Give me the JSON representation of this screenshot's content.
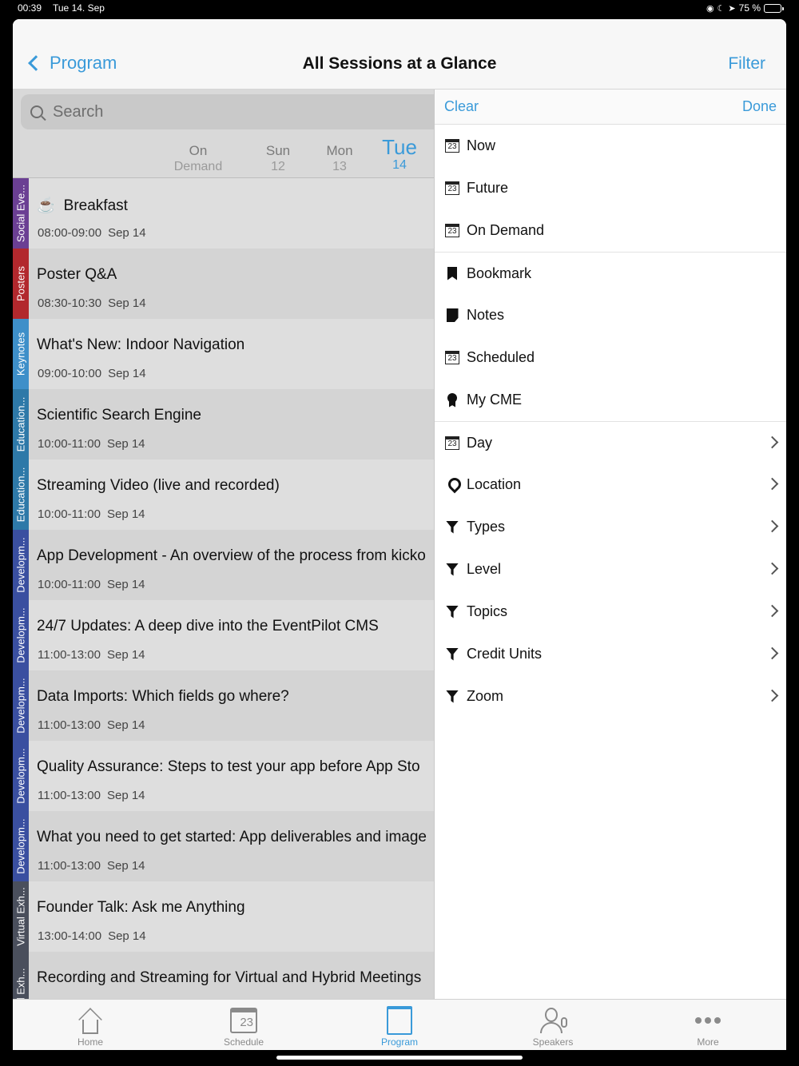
{
  "status_bar": {
    "time": "00:39",
    "date": "Tue 14. Sep",
    "battery_text": "75 %",
    "battery_level": 0.75
  },
  "nav": {
    "back_label": "Program",
    "title": "All Sessions at a Glance",
    "filter_label": "Filter"
  },
  "search": {
    "placeholder": "Search"
  },
  "days": [
    {
      "name": "On",
      "num": "Demand"
    },
    {
      "name": "Sun",
      "num": "12"
    },
    {
      "name": "Mon",
      "num": "13"
    },
    {
      "name": "Tue",
      "num": "14"
    }
  ],
  "sessions": [
    {
      "tag": "Social Eve...",
      "color": "#6b3f93",
      "title": "Breakfast",
      "time": "08:00-09:00",
      "date": "Sep 14",
      "icon": "coffee-icon"
    },
    {
      "tag": "Posters",
      "color": "#b2282d",
      "title": "Poster Q&A",
      "time": "08:30-10:30",
      "date": "Sep 14"
    },
    {
      "tag": "Keynotes",
      "color": "#3e8fc9",
      "title": "What's New: Indoor Navigation",
      "time": "09:00-10:00",
      "date": "Sep 14"
    },
    {
      "tag": "Education...",
      "color": "#2e79a8",
      "title": "Scientific Search Engine",
      "time": "10:00-11:00",
      "date": "Sep 14"
    },
    {
      "tag": "Education...",
      "color": "#2e79a8",
      "title": "Streaming Video (live and recorded)",
      "time": "10:00-11:00",
      "date": "Sep 14"
    },
    {
      "tag": "Developm...",
      "color": "#3a4fa0",
      "title": "App Development - An overview of the process from kicko",
      "time": "10:00-11:00",
      "date": "Sep 14"
    },
    {
      "tag": "Developm...",
      "color": "#3a4fa0",
      "title": "24/7 Updates: A deep dive into the EventPilot CMS",
      "time": "11:00-13:00",
      "date": "Sep 14"
    },
    {
      "tag": "Developm...",
      "color": "#3a4fa0",
      "title": "Data Imports: Which fields go where?",
      "time": "11:00-13:00",
      "date": "Sep 14"
    },
    {
      "tag": "Developm...",
      "color": "#3a4fa0",
      "title": "Quality Assurance: Steps to test your app before App Sto",
      "time": "11:00-13:00",
      "date": "Sep 14"
    },
    {
      "tag": "Developm...",
      "color": "#3a4fa0",
      "title": "What you need to get started: App deliverables and image",
      "time": "11:00-13:00",
      "date": "Sep 14"
    },
    {
      "tag": "Virtual Exh...",
      "color": "#4a4f5c",
      "title": "Founder Talk: Ask me Anything",
      "time": "13:00-14:00",
      "date": "Sep 14"
    },
    {
      "tag": "al Exh...",
      "color": "#4a4f5c",
      "title": "Recording and Streaming for Virtual and Hybrid Meetings",
      "time": "",
      "date": ""
    }
  ],
  "filter_panel": {
    "clear_label": "Clear",
    "done_label": "Done",
    "items": [
      {
        "label": "Now",
        "icon": "calendar-icon",
        "cal_num": "23"
      },
      {
        "label": "Future",
        "icon": "calendar-icon",
        "cal_num": "23"
      },
      {
        "label": "On Demand",
        "icon": "calendar-icon",
        "cal_num": "23"
      },
      {
        "label": "Bookmark",
        "icon": "bookmark-icon"
      },
      {
        "label": "Notes",
        "icon": "notes-icon"
      },
      {
        "label": "Scheduled",
        "icon": "calendar-icon",
        "cal_num": "23"
      },
      {
        "label": "My CME",
        "icon": "medal-icon"
      },
      {
        "label": "Day",
        "icon": "calendar-icon",
        "cal_num": "23"
      },
      {
        "label": "Location",
        "icon": "location-pin-icon"
      },
      {
        "label": "Types",
        "icon": "funnel-icon"
      },
      {
        "label": "Level",
        "icon": "funnel-icon"
      },
      {
        "label": "Topics",
        "icon": "funnel-icon"
      },
      {
        "label": "Credit Units",
        "icon": "funnel-icon"
      },
      {
        "label": "Zoom",
        "icon": "funnel-icon"
      }
    ]
  },
  "tabs": [
    {
      "label": "Home",
      "icon": "home-icon"
    },
    {
      "label": "Schedule",
      "icon": "schedule-icon",
      "icon_num": "23"
    },
    {
      "label": "Program",
      "icon": "program-icon"
    },
    {
      "label": "Speakers",
      "icon": "speakers-icon"
    },
    {
      "label": "More",
      "icon": "more-icon"
    }
  ],
  "colors": {
    "accent": "#3a9ad9"
  }
}
